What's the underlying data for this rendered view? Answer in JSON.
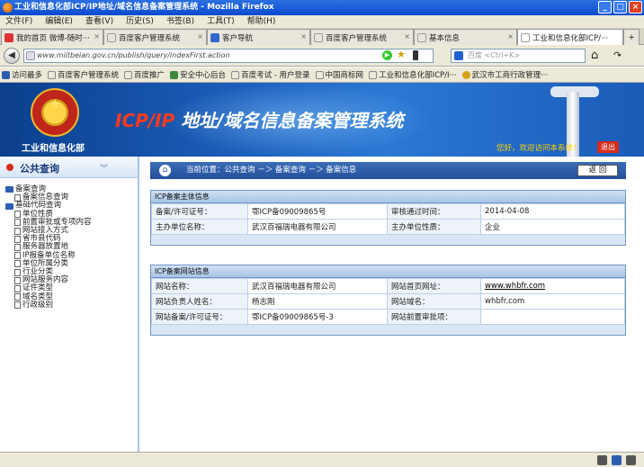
{
  "window": {
    "title": "工业和信息化部ICP/IP地址/域名信息备案管理系统 - Mozilla Firefox",
    "buttons": [
      "_",
      "□",
      "×"
    ]
  },
  "menu": [
    "文件(F)",
    "编辑(E)",
    "查看(V)",
    "历史(S)",
    "书签(B)",
    "工具(T)",
    "帮助(H)"
  ],
  "tabs": [
    {
      "label": "我的首页 微博-随时···",
      "icon_color": "#d33"
    },
    {
      "label": "百度客户管理系统",
      "icon_color": "#888"
    },
    {
      "label": "客户导航",
      "icon_color": "#36c"
    },
    {
      "label": "百度客户管理系统",
      "icon_color": "#888"
    },
    {
      "label": "基本信息",
      "icon_color": "#888"
    },
    {
      "label": "工业和信息化部ICP/···",
      "icon_color": "#888"
    }
  ],
  "tab_new": "+",
  "nav": {
    "back": "◀",
    "url": "www.miitbeian.gov.cn/publish/query/indexFirst.action",
    "search_placeholder": "百度 <Ctrl+K>",
    "home": "⌂",
    "refresh": "↷"
  },
  "bookmarks": [
    {
      "label": "访问最多",
      "icon_color": "#2a5db0"
    },
    {
      "label": "百度客户管理系统",
      "icon_color": "#888"
    },
    {
      "label": "百度推广",
      "icon_color": "#888"
    },
    {
      "label": "安全中心后台",
      "icon_color": "#3a8a3a"
    },
    {
      "label": "百度考试 - 用户登录",
      "icon_color": "#888"
    },
    {
      "label": "中国商标网",
      "icon_color": "#888"
    },
    {
      "label": "工业和信息化部ICP/I···",
      "icon_color": "#888"
    },
    {
      "label": "武汉市工商行政管理···",
      "icon_color": "#d4a017"
    }
  ],
  "banner": {
    "ministry": "工业和信息化部",
    "title_prefix": "ICP/IP",
    "title_rest": " 地址/域名信息备案管理系统",
    "welcome": "您好，欢迎访问本系统！",
    "logout": "退出"
  },
  "sidebar": {
    "title": "公共查询",
    "collapse": "︾",
    "groups": [
      {
        "label": "备案查询",
        "items": [
          "备案信息查询"
        ]
      },
      {
        "label": "基础代码查询",
        "items": [
          "单位性质",
          "前置审批或专项内容",
          "网站接入方式",
          "省市县代码",
          "服务器放置地",
          "IP报备单位名称",
          "单位所属分类",
          "行业分类",
          "网站服务内容",
          "证件类型",
          "域名类型",
          "行政级别"
        ]
      }
    ]
  },
  "breadcrumb": {
    "text": "当前位置：公共查询 －＞ 备案查询 －＞ 备案信息",
    "back": "返 回",
    "home": "⌂"
  },
  "icp_subject": {
    "title": "ICP备案主体信息",
    "rows": [
      {
        "k1": "备案/许可证号：",
        "v1": "鄂ICP备09009865号",
        "k2": "审核通过时间：",
        "v2": "2014-04-08"
      },
      {
        "k1": "主办单位名称：",
        "v1": "武汉百福瑞电器有限公司",
        "k2": "主办单位性质：",
        "v2": "企业"
      }
    ]
  },
  "icp_site": {
    "title": "ICP备案网站信息",
    "rows": [
      {
        "k1": "网站名称：",
        "v1": "武汉百福瑞电器有限公司",
        "k2": "网站首页网址：",
        "v2": "www.whbfr.com"
      },
      {
        "k1": "网站负责人姓名：",
        "v1": "杨志刚",
        "k2": "网站域名：",
        "v2": "whbfr.com"
      },
      {
        "k1": "网站备案/许可证号：",
        "v1": "鄂ICP备09009865号-3",
        "k2": "网站前置审批项：",
        "v2": ""
      }
    ]
  }
}
